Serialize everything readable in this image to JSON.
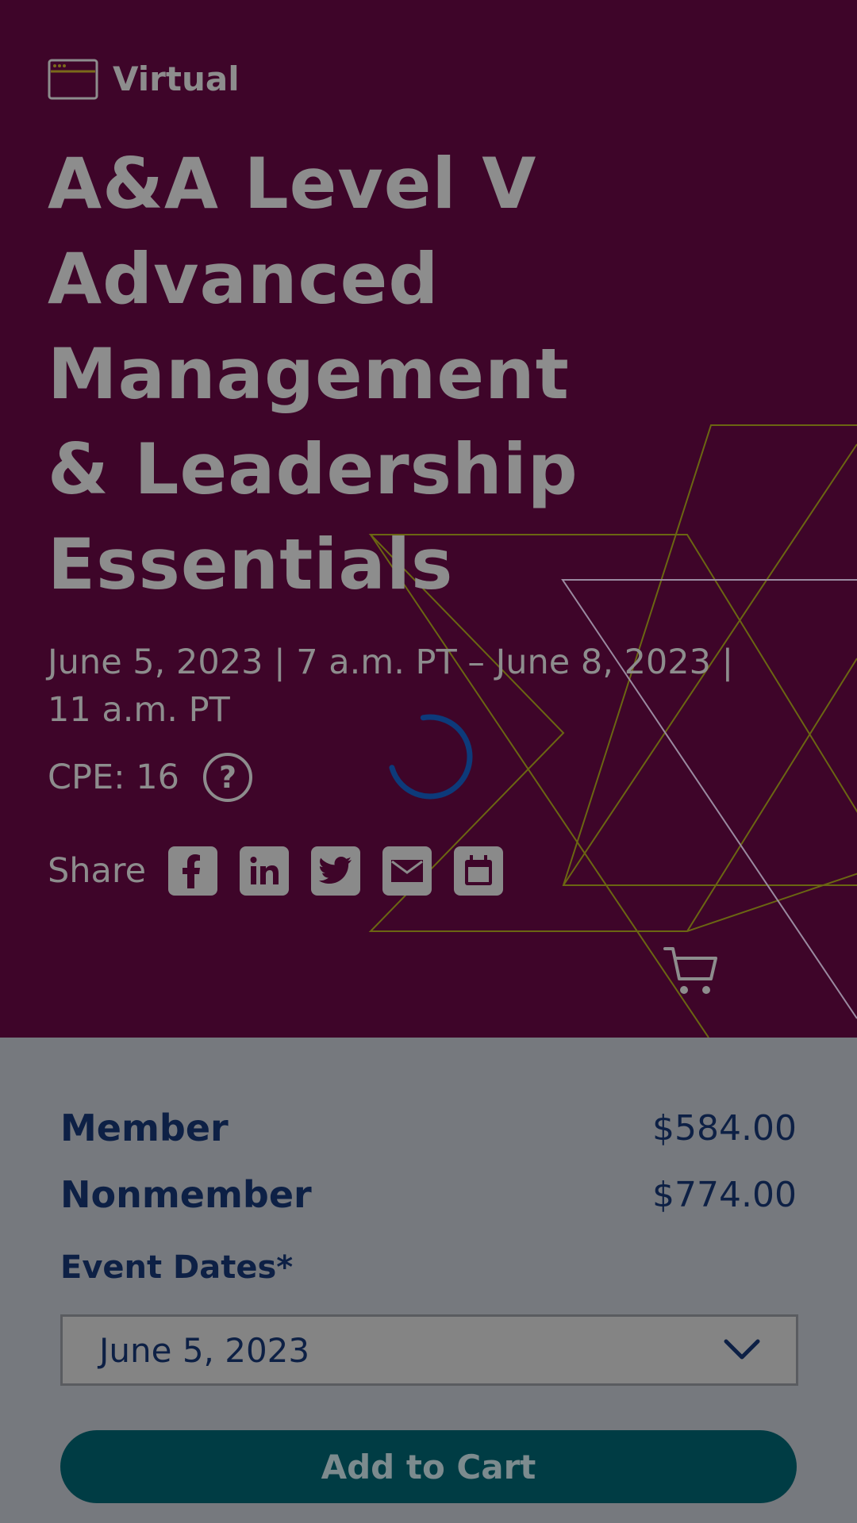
{
  "event": {
    "format_label": "Virtual",
    "title": "A&A Level V Advanced Management & Leadership Essentials",
    "dates": "June 5, 2023 | 7 a.m. PT – June 8, 2023 | 11 a.m. PT",
    "cpe": "CPE: 16",
    "help_icon_text": "?"
  },
  "share": {
    "label": "Share",
    "buttons": [
      "facebook-icon",
      "linkedin-icon",
      "twitter-icon",
      "email-icon",
      "calendar-icon"
    ]
  },
  "pricing": {
    "rows": [
      {
        "label": "Member",
        "price": "$584.00"
      },
      {
        "label": "Nonmember",
        "price": "$774.00"
      }
    ]
  },
  "form": {
    "event_dates_label": "Event Dates*",
    "event_dates_selected": "June 5, 2023",
    "add_to_cart_label": "Add to Cart"
  },
  "colors": {
    "hero_background": "#3e0529",
    "overlay_gray": "#76797e",
    "navy_text": "#0d2045",
    "button_teal": "#003c44",
    "spinner_blue": "#0d3a7a",
    "decor_gold": "#6b6612"
  },
  "icons": {
    "format": "browser-window-icon",
    "cart": "shopping-cart-icon",
    "select": "chevron-down-icon",
    "loading": "loading-spinner-icon"
  }
}
